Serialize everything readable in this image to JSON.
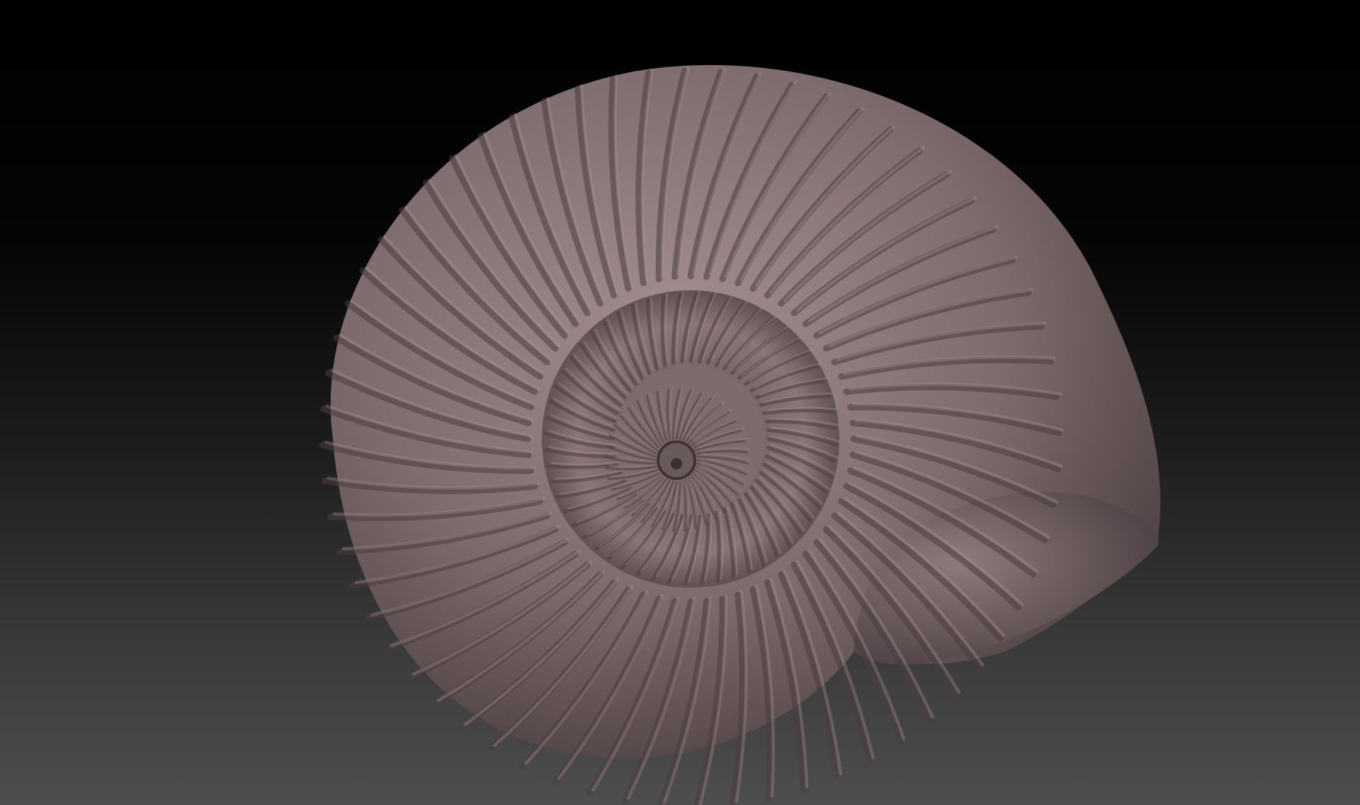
{
  "scene": {
    "subject": "ammonite-fossil-sculpt",
    "icon": "ammonite-shell-icon",
    "colors": {
      "background_top": "#000000",
      "background_bottom": "#4e4e4e",
      "material_base": "#7d6a6c",
      "material_light": "#a89497",
      "material_shadow": "#3b3032",
      "rib_shadow": "#4a3d3f"
    }
  }
}
